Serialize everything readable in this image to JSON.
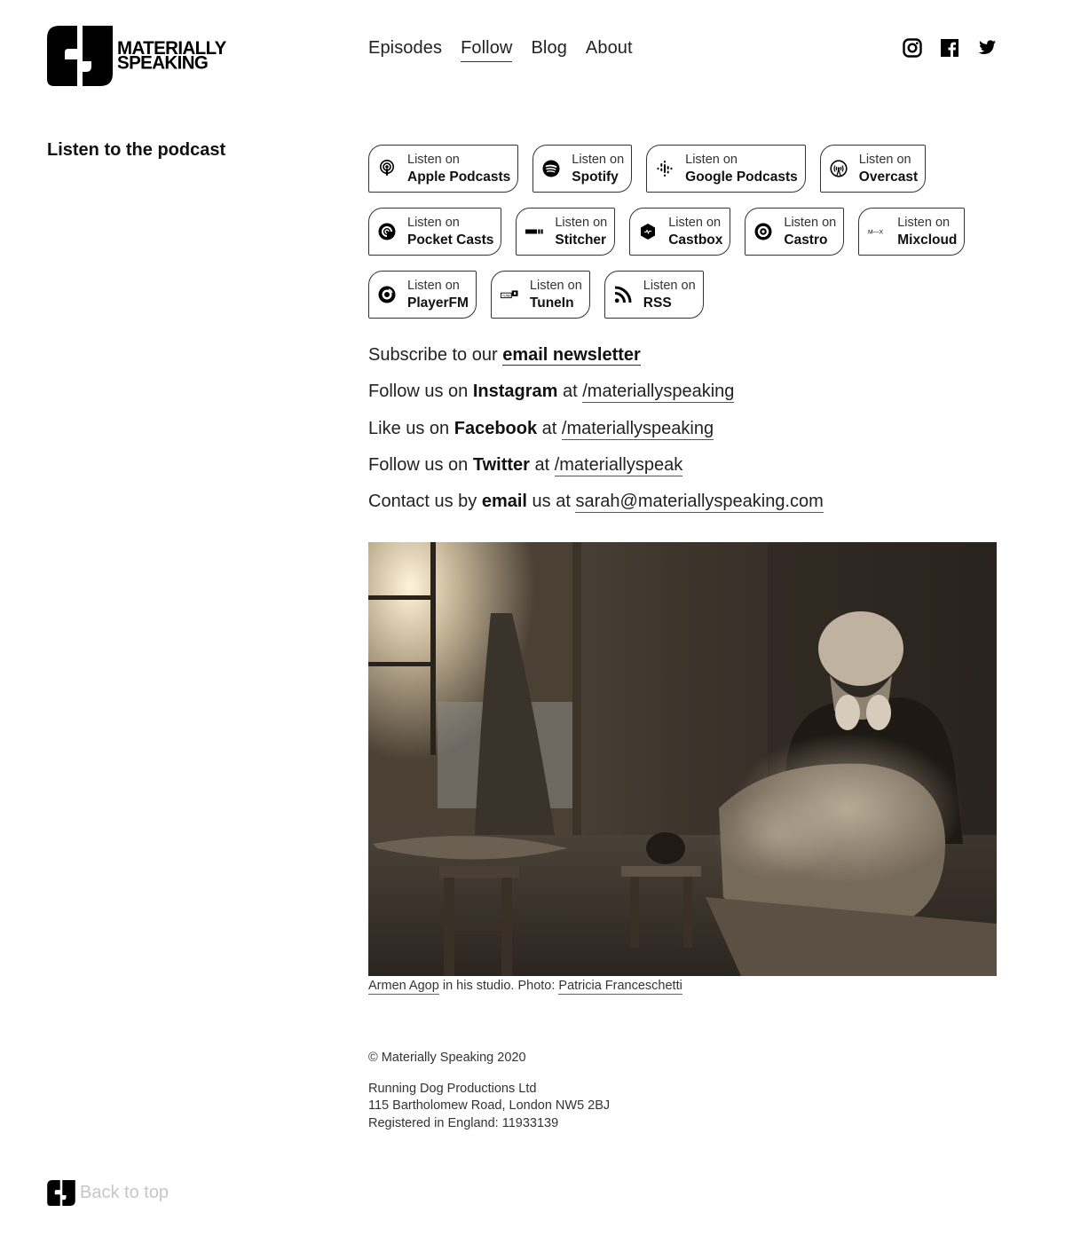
{
  "brand": {
    "line1": "MATERIALLY",
    "line2": "SPEAKING"
  },
  "nav": [
    {
      "label": "Episodes",
      "active": false
    },
    {
      "label": "Follow",
      "active": true
    },
    {
      "label": "Blog",
      "active": false
    },
    {
      "label": "About",
      "active": false
    }
  ],
  "social_icons": [
    "instagram-icon",
    "facebook-icon",
    "twitter-icon"
  ],
  "sidebar": {
    "title": "Listen to the podcast"
  },
  "listen_buttons": [
    {
      "prefix": "Listen on",
      "platform": "Apple Podcasts",
      "icon": "apple-podcasts-icon"
    },
    {
      "prefix": "Listen on",
      "platform": "Spotify",
      "icon": "spotify-icon"
    },
    {
      "prefix": "Listen on",
      "platform": "Google Podcasts",
      "icon": "google-podcasts-icon"
    },
    {
      "prefix": "Listen on",
      "platform": "Overcast",
      "icon": "overcast-icon"
    },
    {
      "prefix": "Listen on",
      "platform": "Pocket Casts",
      "icon": "pocket-casts-icon"
    },
    {
      "prefix": "Listen on",
      "platform": "Stitcher",
      "icon": "stitcher-icon"
    },
    {
      "prefix": "Listen on",
      "platform": "Castbox",
      "icon": "castbox-icon"
    },
    {
      "prefix": "Listen on",
      "platform": "Castro",
      "icon": "castro-icon"
    },
    {
      "prefix": "Listen on",
      "platform": "Mixcloud",
      "icon": "mixcloud-icon"
    },
    {
      "prefix": "Listen on",
      "platform": "PlayerFM",
      "icon": "playerfm-icon"
    },
    {
      "prefix": "Listen on",
      "platform": "TuneIn",
      "icon": "tunein-icon"
    },
    {
      "prefix": "Listen on",
      "platform": "RSS",
      "icon": "rss-icon"
    }
  ],
  "follow": {
    "newsletter": {
      "pre": "Subscribe to our ",
      "link": "email newsletter"
    },
    "instagram": {
      "pre": "Follow us on ",
      "name": "Instagram",
      "mid": " at ",
      "link": "/materiallyspeaking"
    },
    "facebook": {
      "pre": "Like us on ",
      "name": "Facebook",
      "mid": " at ",
      "link": "/materiallyspeaking"
    },
    "twitter": {
      "pre": "Follow us on ",
      "name": "Twitter",
      "mid": " at ",
      "link": "/materiallyspeak"
    },
    "email": {
      "pre": "Contact us by ",
      "name": "email",
      "mid": " us at ",
      "link": "sarah@materiallyspeaking.com"
    }
  },
  "photo": {
    "alt": "Sculptor in dusty studio sanding a stone piece",
    "caption_person": "Armen Agop",
    "caption_mid": " in his studio. Photo: ",
    "caption_credit": "Patricia Franceschetti"
  },
  "footer": {
    "copyright": "© Materially Speaking 2020",
    "company": "Running Dog Productions Ltd",
    "address": "115 Bartholomew Road, London NW5 2BJ",
    "registered": "Registered in England: 11933139",
    "back_to_top": "Back to top"
  }
}
